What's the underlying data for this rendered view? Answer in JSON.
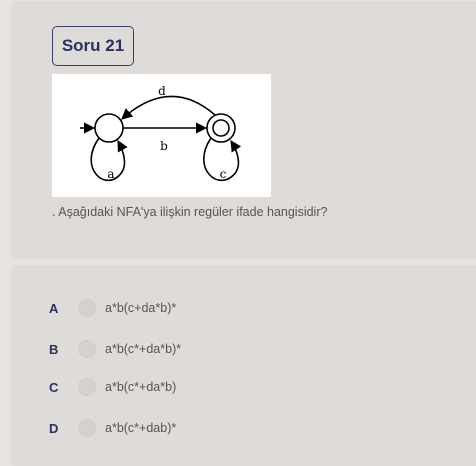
{
  "question": {
    "badge": "Soru 21",
    "text": ". Aşağıdaki NFA'ya ilişkin regüler ifade hangisidir?",
    "diagram": {
      "labels": {
        "top_arc": "d",
        "middle_arrow": "b",
        "left_loop": "a",
        "right_loop": "c"
      }
    }
  },
  "options": [
    {
      "letter": "A",
      "text": "a*b(c+da*b)*"
    },
    {
      "letter": "B",
      "text": "a*b(c*+da*b)*"
    },
    {
      "letter": "C",
      "text": "a*b(c*+da*b)"
    },
    {
      "letter": "D",
      "text": "a*b(c*+dab)*"
    }
  ]
}
